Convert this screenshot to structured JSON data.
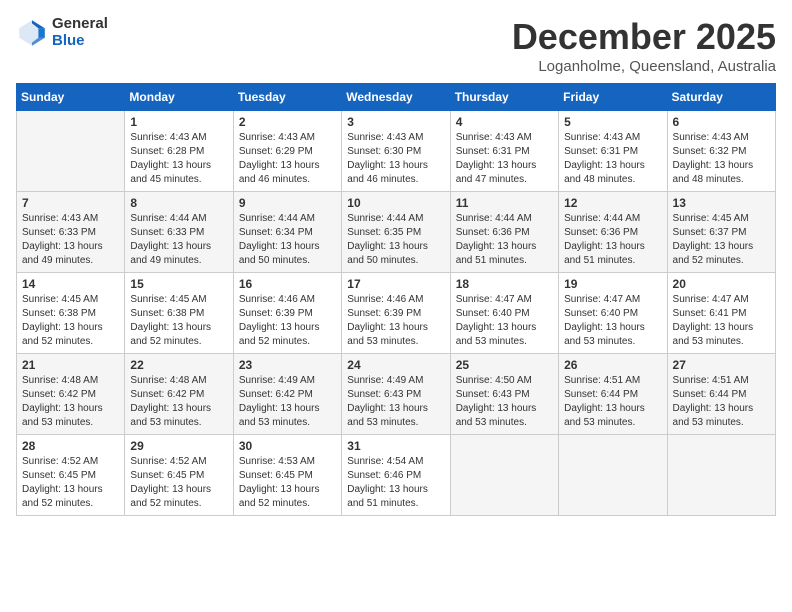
{
  "header": {
    "logo_general": "General",
    "logo_blue": "Blue",
    "month": "December 2025",
    "location": "Loganholme, Queensland, Australia"
  },
  "days_of_week": [
    "Sunday",
    "Monday",
    "Tuesday",
    "Wednesday",
    "Thursday",
    "Friday",
    "Saturday"
  ],
  "weeks": [
    [
      {
        "day": "",
        "empty": true
      },
      {
        "day": "1",
        "sunrise": "4:43 AM",
        "sunset": "6:28 PM",
        "daylight": "13 hours and 45 minutes."
      },
      {
        "day": "2",
        "sunrise": "4:43 AM",
        "sunset": "6:29 PM",
        "daylight": "13 hours and 46 minutes."
      },
      {
        "day": "3",
        "sunrise": "4:43 AM",
        "sunset": "6:30 PM",
        "daylight": "13 hours and 46 minutes."
      },
      {
        "day": "4",
        "sunrise": "4:43 AM",
        "sunset": "6:31 PM",
        "daylight": "13 hours and 47 minutes."
      },
      {
        "day": "5",
        "sunrise": "4:43 AM",
        "sunset": "6:31 PM",
        "daylight": "13 hours and 48 minutes."
      },
      {
        "day": "6",
        "sunrise": "4:43 AM",
        "sunset": "6:32 PM",
        "daylight": "13 hours and 48 minutes."
      }
    ],
    [
      {
        "day": "7",
        "sunrise": "4:43 AM",
        "sunset": "6:33 PM",
        "daylight": "13 hours and 49 minutes."
      },
      {
        "day": "8",
        "sunrise": "4:44 AM",
        "sunset": "6:33 PM",
        "daylight": "13 hours and 49 minutes."
      },
      {
        "day": "9",
        "sunrise": "4:44 AM",
        "sunset": "6:34 PM",
        "daylight": "13 hours and 50 minutes."
      },
      {
        "day": "10",
        "sunrise": "4:44 AM",
        "sunset": "6:35 PM",
        "daylight": "13 hours and 50 minutes."
      },
      {
        "day": "11",
        "sunrise": "4:44 AM",
        "sunset": "6:36 PM",
        "daylight": "13 hours and 51 minutes."
      },
      {
        "day": "12",
        "sunrise": "4:44 AM",
        "sunset": "6:36 PM",
        "daylight": "13 hours and 51 minutes."
      },
      {
        "day": "13",
        "sunrise": "4:45 AM",
        "sunset": "6:37 PM",
        "daylight": "13 hours and 52 minutes."
      }
    ],
    [
      {
        "day": "14",
        "sunrise": "4:45 AM",
        "sunset": "6:38 PM",
        "daylight": "13 hours and 52 minutes."
      },
      {
        "day": "15",
        "sunrise": "4:45 AM",
        "sunset": "6:38 PM",
        "daylight": "13 hours and 52 minutes."
      },
      {
        "day": "16",
        "sunrise": "4:46 AM",
        "sunset": "6:39 PM",
        "daylight": "13 hours and 52 minutes."
      },
      {
        "day": "17",
        "sunrise": "4:46 AM",
        "sunset": "6:39 PM",
        "daylight": "13 hours and 53 minutes."
      },
      {
        "day": "18",
        "sunrise": "4:47 AM",
        "sunset": "6:40 PM",
        "daylight": "13 hours and 53 minutes."
      },
      {
        "day": "19",
        "sunrise": "4:47 AM",
        "sunset": "6:40 PM",
        "daylight": "13 hours and 53 minutes."
      },
      {
        "day": "20",
        "sunrise": "4:47 AM",
        "sunset": "6:41 PM",
        "daylight": "13 hours and 53 minutes."
      }
    ],
    [
      {
        "day": "21",
        "sunrise": "4:48 AM",
        "sunset": "6:42 PM",
        "daylight": "13 hours and 53 minutes."
      },
      {
        "day": "22",
        "sunrise": "4:48 AM",
        "sunset": "6:42 PM",
        "daylight": "13 hours and 53 minutes."
      },
      {
        "day": "23",
        "sunrise": "4:49 AM",
        "sunset": "6:42 PM",
        "daylight": "13 hours and 53 minutes."
      },
      {
        "day": "24",
        "sunrise": "4:49 AM",
        "sunset": "6:43 PM",
        "daylight": "13 hours and 53 minutes."
      },
      {
        "day": "25",
        "sunrise": "4:50 AM",
        "sunset": "6:43 PM",
        "daylight": "13 hours and 53 minutes."
      },
      {
        "day": "26",
        "sunrise": "4:51 AM",
        "sunset": "6:44 PM",
        "daylight": "13 hours and 53 minutes."
      },
      {
        "day": "27",
        "sunrise": "4:51 AM",
        "sunset": "6:44 PM",
        "daylight": "13 hours and 53 minutes."
      }
    ],
    [
      {
        "day": "28",
        "sunrise": "4:52 AM",
        "sunset": "6:45 PM",
        "daylight": "13 hours and 52 minutes."
      },
      {
        "day": "29",
        "sunrise": "4:52 AM",
        "sunset": "6:45 PM",
        "daylight": "13 hours and 52 minutes."
      },
      {
        "day": "30",
        "sunrise": "4:53 AM",
        "sunset": "6:45 PM",
        "daylight": "13 hours and 52 minutes."
      },
      {
        "day": "31",
        "sunrise": "4:54 AM",
        "sunset": "6:46 PM",
        "daylight": "13 hours and 51 minutes."
      },
      {
        "day": "",
        "empty": true
      },
      {
        "day": "",
        "empty": true
      },
      {
        "day": "",
        "empty": true
      }
    ]
  ]
}
